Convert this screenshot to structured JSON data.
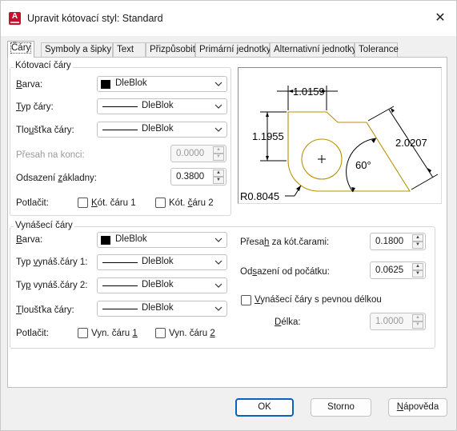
{
  "window": {
    "title": "Upravit kótovací styl: Standard"
  },
  "tabs": [
    "Čáry",
    "Symboly a šipky",
    "Text",
    "Přizpůsobit",
    "Primární jednotky",
    "Alternativní jednotky",
    "Tolerance"
  ],
  "dim_lines": {
    "group_title": "Kótovací čáry",
    "color_label": "Barva:",
    "color_value": "DleBlok",
    "linetype_label": "Typ čáry:",
    "linetype_value": "DleBlok",
    "lineweight_label": "Tloušťka čáry:",
    "lineweight_value": "DleBlok",
    "extend_label": "Přesah na konci:",
    "extend_value": "0.0000",
    "baseline_label": "Odsazení základny:",
    "baseline_value": "0.3800",
    "suppress_label": "Potlačit:",
    "suppress_1": "Kót. čáru 1",
    "suppress_2": "Kót. čáru 2"
  },
  "ext_lines": {
    "group_title": "Vynášecí čáry",
    "color_label": "Barva:",
    "color_value": "DleBlok",
    "linetype1_label": "Typ vynáš.čáry 1:",
    "linetype1_value": "DleBlok",
    "linetype2_label": "Typ vynáš.čáry 2:",
    "linetype2_value": "DleBlok",
    "lineweight_label": "Tloušťka čáry:",
    "lineweight_value": "DleBlok",
    "suppress_label": "Potlačit:",
    "suppress_1": "Vyn. čáru 1",
    "suppress_2": "Vyn. čáru 2",
    "extend_beyond_label": "Přesah za kót.čarami:",
    "extend_beyond_value": "0.1800",
    "offset_origin_label": "Odsazení od počátku:",
    "offset_origin_value": "0.0625",
    "fixed_length_label": "Vynášecí čáry s pevnou délkou",
    "length_label": "Délka:",
    "length_value": "1.0000"
  },
  "preview": {
    "dim_top": "1.0159",
    "dim_left": "1.1955",
    "dim_right": "2.0207",
    "angle": "60°",
    "radius": "R0.8045"
  },
  "buttons": {
    "ok": "OK",
    "cancel": "Storno",
    "help": "Nápověda"
  }
}
